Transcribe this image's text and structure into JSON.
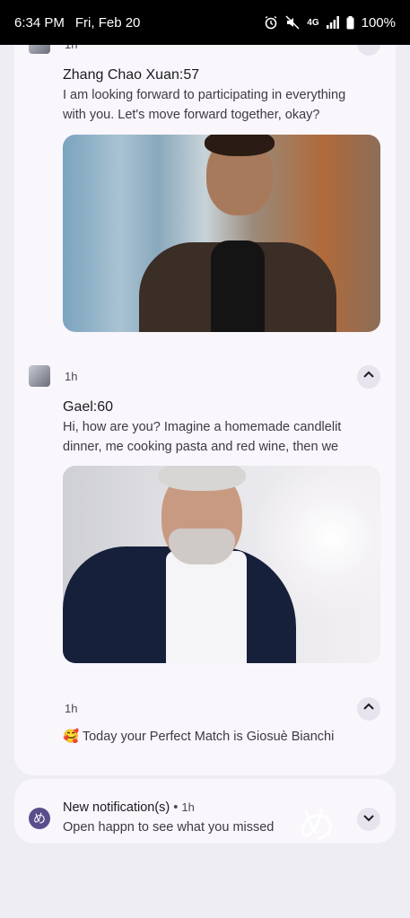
{
  "status_bar": {
    "time": "6:34 PM",
    "date": "Fri, Feb 20",
    "network": "4G",
    "battery": "100%"
  },
  "notifications": [
    {
      "partial_time": "1h",
      "title": "Zhang Chao Xuan:57",
      "body": "I am looking forward to participating in everything with you. Let's move forward together, okay?",
      "image": "man-leather-jacket-photo"
    },
    {
      "time": "1h",
      "title": "Gael:60",
      "body": "Hi, how are you? Imagine a homemade candlelit dinner, me cooking pasta and red wine, then we slo…",
      "image": "man-suit-photo"
    },
    {
      "time": "1h",
      "emoji": "🥰",
      "body": "Today your Perfect Match is Giosuè Bianchi"
    }
  ],
  "summary": {
    "logo_glyph": "め",
    "title": "New notification(s)",
    "time": "1h",
    "body": "Open happn to see what you missed"
  },
  "icons": {
    "alarm": "alarm-icon",
    "mute": "mute-icon",
    "signal": "signal-icon",
    "battery": "battery-icon",
    "expand": "chevron-up-icon",
    "collapse": "chevron-down-icon"
  }
}
